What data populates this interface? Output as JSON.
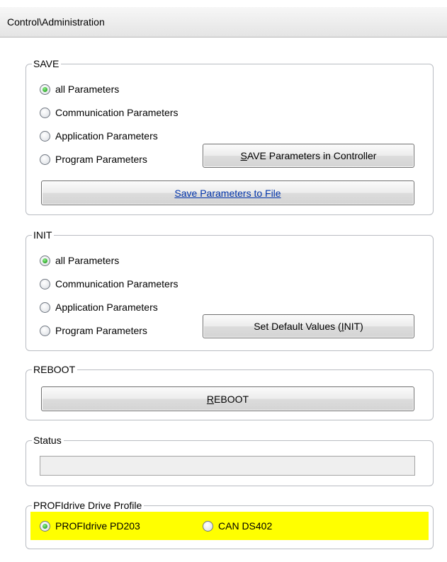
{
  "window": {
    "title": "Control\\Administration"
  },
  "save_group": {
    "legend": "SAVE",
    "options": [
      {
        "label": "all Parameters",
        "checked": true
      },
      {
        "label": "Communication Parameters",
        "checked": false
      },
      {
        "label": "Application Parameters",
        "checked": false
      },
      {
        "label": "Program Parameters",
        "checked": false
      }
    ],
    "save_controller_button": {
      "mnemonic": "S",
      "rest": "AVE Parameters in Controller"
    },
    "save_file_button": "Save Parameters to File"
  },
  "init_group": {
    "legend": "INIT",
    "options": [
      {
        "label": "all Parameters",
        "checked": true
      },
      {
        "label": "Communication Parameters",
        "checked": false
      },
      {
        "label": "Application Parameters",
        "checked": false
      },
      {
        "label": "Program Parameters",
        "checked": false
      }
    ],
    "default_button": {
      "before": "Set Default Values (",
      "mnemonic": "I",
      "after": "NIT)"
    }
  },
  "reboot_group": {
    "legend": "REBOOT",
    "button": {
      "mnemonic": "R",
      "rest": "EBOOT"
    }
  },
  "status_group": {
    "legend": "Status",
    "value": ""
  },
  "profile_group": {
    "legend": "PROFIdrive Drive Profile",
    "highlight_color": "#ffff00",
    "options": [
      {
        "label": "PROFIdrive PD203",
        "checked": true
      },
      {
        "label": "CAN DS402",
        "checked": false
      }
    ]
  }
}
